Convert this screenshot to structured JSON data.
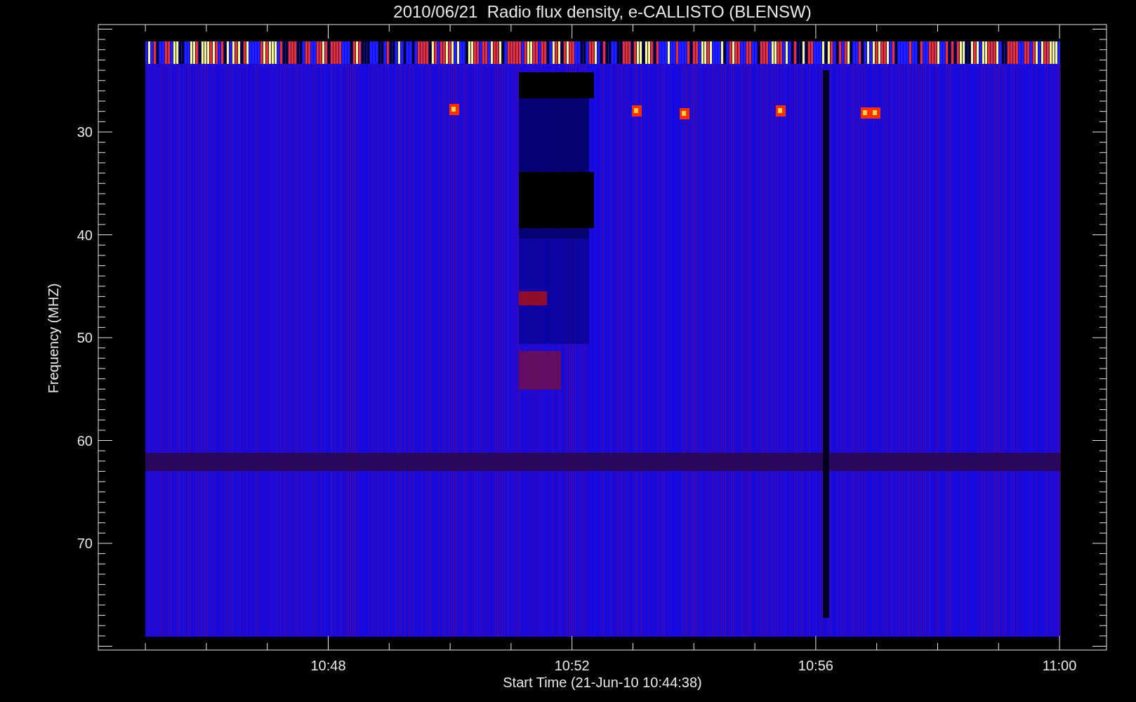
{
  "plot": {
    "title": "2010/06/21  Radio flux density, e-CALLISTO (BLENSW)",
    "xlabel": "Start Time (21-Jun-10 10:44:38)",
    "ylabel": "Frequency (MHZ)",
    "xticks": [
      "10:48",
      "10:52",
      "10:56",
      "11:00"
    ],
    "yticks": [
      "30",
      "40",
      "50",
      "60",
      "70"
    ]
  }
}
